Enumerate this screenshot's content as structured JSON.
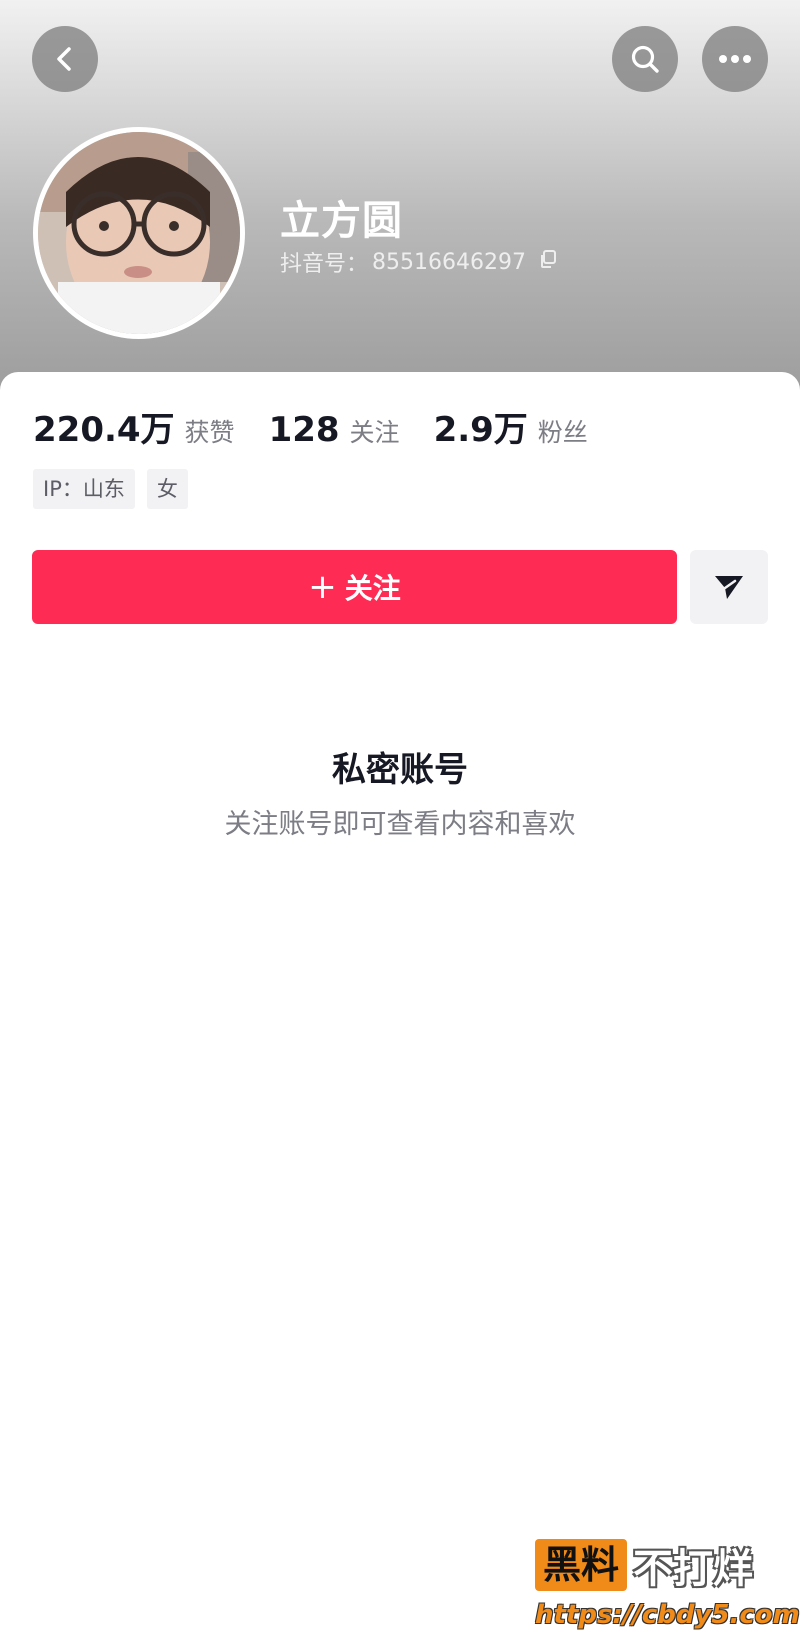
{
  "header": {
    "back_icon": "chevron-left-icon",
    "search_icon": "search-icon",
    "more_icon": "more-horizontal-icon",
    "nickname": "立方圆",
    "douyin_id_label": "抖音号：",
    "douyin_id": "85516646297",
    "copy_icon": "copy-icon"
  },
  "stats": [
    {
      "value": "220.4万",
      "label": "获赞"
    },
    {
      "value": "128",
      "label": "关注"
    },
    {
      "value": "2.9万",
      "label": "粉丝"
    }
  ],
  "tags": [
    "IP：山东",
    "女"
  ],
  "actions": {
    "follow_plus": "+",
    "follow_label": "关注",
    "share_icon": "send-icon"
  },
  "private": {
    "title": "私密账号",
    "description": "关注账号即可查看内容和喜欢"
  },
  "watermark": {
    "box_text": "黑料",
    "text": "不打烊",
    "url": "https://cbdy5.com"
  },
  "colors": {
    "accent": "#fe2c55",
    "text_primary": "#161823",
    "text_secondary": "#7c7d85",
    "watermark_orange": "#f08a18"
  }
}
